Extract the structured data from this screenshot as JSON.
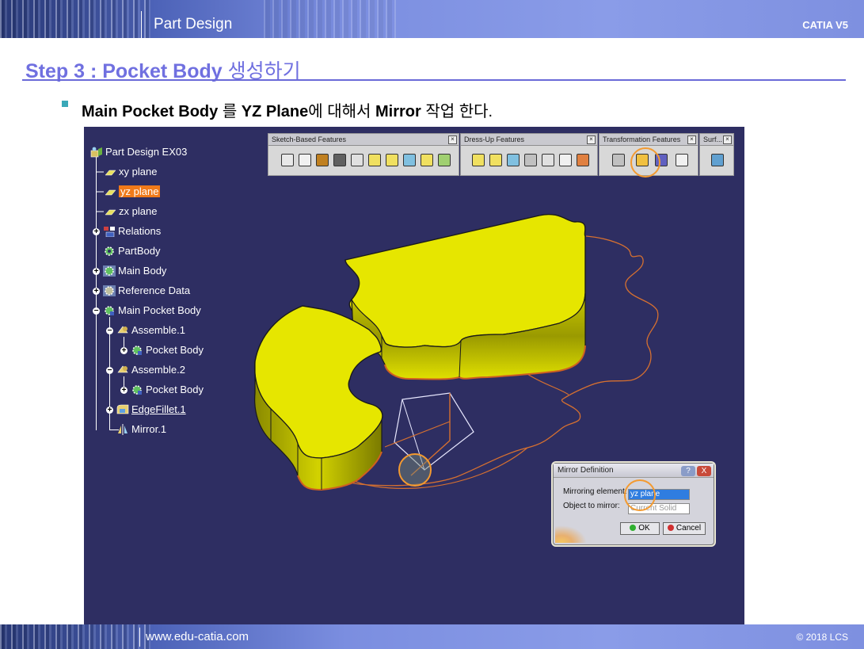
{
  "header": {
    "title": "Part Design",
    "product": "CATIA V5"
  },
  "footer": {
    "website": "www.edu-catia.com",
    "copyright": "© 2018 LCS"
  },
  "slide": {
    "step_title_bold": "Step 3 : Pocket Body",
    "step_title_korean": " 생성하기",
    "bullet": {
      "t1": "Main Pocket Body",
      "t2": " 를 ",
      "t3": "YZ Plane",
      "t4": "에 대해서 ",
      "t5": "Mirror",
      "t6": " 작업 한다."
    }
  },
  "tree": {
    "root": "Part Design EX03",
    "xy": "xy plane",
    "yz": "yz plane",
    "zx": "zx plane",
    "relations": "Relations",
    "partbody": "PartBody",
    "mainbody": "Main Body",
    "refdata": "Reference Data",
    "mainpocket": "Main Pocket Body",
    "assemble1": "Assemble.1",
    "pocket1": "Pocket Body",
    "assemble2": "Assemble.2",
    "pocket2": "Pocket Body",
    "edgefillet": "EdgeFillet.1",
    "mirror": "Mirror.1"
  },
  "toolbars": {
    "sketch": "Sketch-Based Features",
    "dressup": "Dress-Up Features",
    "transform": "Transformation Features",
    "surf": "Surf..."
  },
  "dialog": {
    "title": "Mirror Definition",
    "help": "?",
    "close": "X",
    "mirror_label": "Mirroring element:",
    "mirror_value": "yz plane",
    "object_label": "Object to mirror:",
    "object_value": "Current Solid",
    "ok": "OK",
    "cancel": "Cancel"
  },
  "colors": {
    "accent": "#7070e0",
    "viewport_bg": "#2e2e62",
    "solid": "#e6e600",
    "selection": "#f07a1a",
    "highlight": "#f39a30"
  }
}
